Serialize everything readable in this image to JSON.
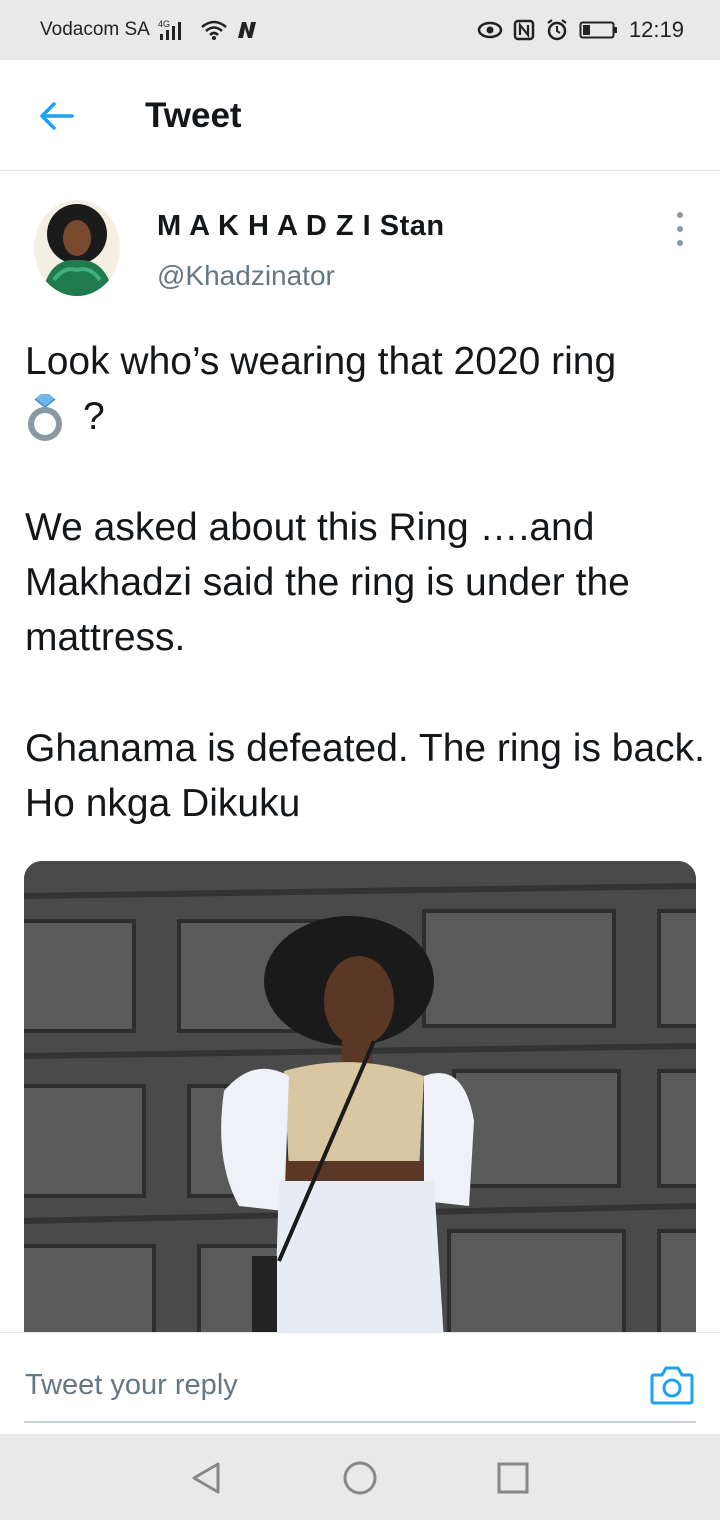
{
  "status_bar": {
    "carrier": "Vodacom SA",
    "network": "4G",
    "time": "12:19",
    "icons": [
      "signal-icon",
      "wifi-icon",
      "n-logo-icon",
      "eye-icon",
      "nfc-icon",
      "alarm-icon",
      "battery-icon"
    ]
  },
  "header": {
    "title": "Tweet",
    "back_icon": "back-arrow-icon"
  },
  "tweet": {
    "author_name": "M A K H A D Z I Stan",
    "author_handle": "@Khadzinator",
    "text_line1": "Look who’s wearing that 2020 ring",
    "ring_emoji": "ring-emoji-icon",
    "text_question": "?",
    "text_para2": "We asked about this Ring ….and Makhadzi said the ring is under the mattress.",
    "text_para3": "Ghanama is defeated. The ring is back. Ho nkga Dikuku",
    "media": "photo of woman in front of grey garage door"
  },
  "reply": {
    "placeholder": "Tweet your reply",
    "camera_icon": "camera-icon"
  },
  "nav": {
    "icons": [
      "nav-back-icon",
      "nav-home-icon",
      "nav-recents-icon"
    ]
  },
  "colors": {
    "accent": "#1da1f2",
    "text": "#14171a",
    "secondary": "#657786",
    "status_bg": "#e9e9e9"
  }
}
